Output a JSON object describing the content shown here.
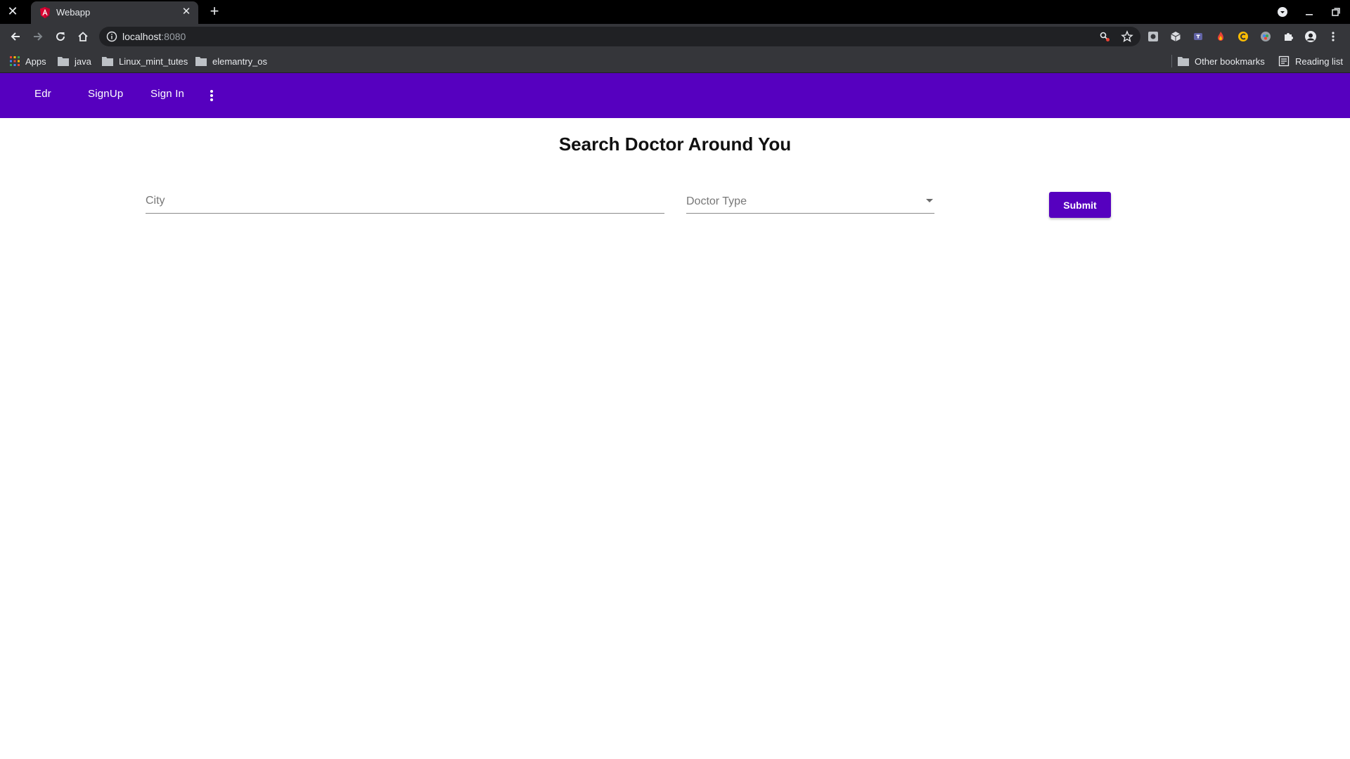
{
  "browser": {
    "tab_title": "Webapp",
    "url_host": "localhost",
    "url_port": ":8080",
    "bookmarks": [
      "Apps",
      "java",
      "Linux_mint_tutes",
      "elemantry_os"
    ],
    "other_bookmarks": "Other bookmarks",
    "reading_list": "Reading list"
  },
  "nav": {
    "brand": "Edr",
    "signup": "SignUp",
    "signin": "Sign In"
  },
  "page": {
    "title": "Search Doctor Around You"
  },
  "form": {
    "city_placeholder": "City",
    "city_value": "",
    "doctor_type_placeholder": "Doctor Type",
    "submit_label": "Submit"
  },
  "colors": {
    "primary": "#5600bf",
    "chrome_dark": "#35363a",
    "tabbar": "#000000"
  }
}
